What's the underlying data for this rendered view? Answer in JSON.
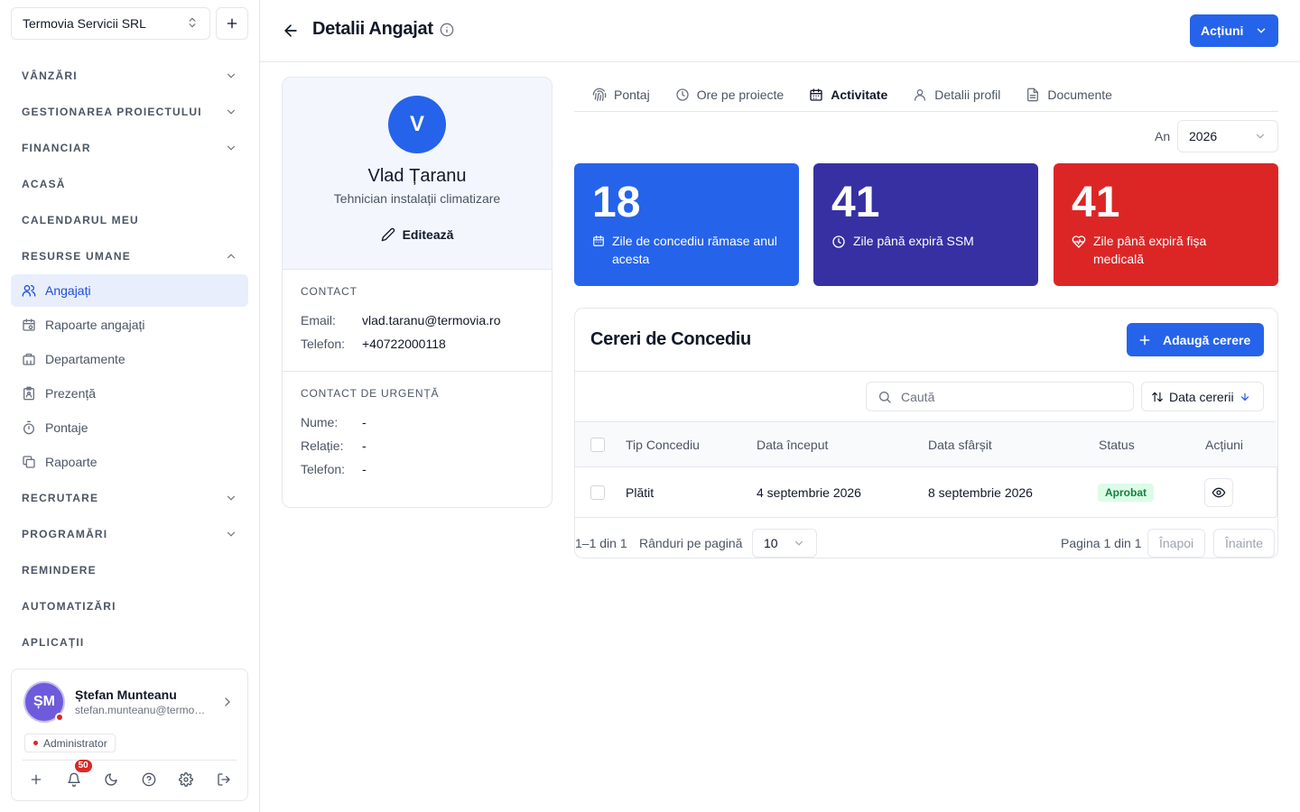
{
  "sidebar": {
    "company": "Termovia Servicii SRL",
    "sections": [
      {
        "label": "VÂNZĂRI"
      },
      {
        "label": "GESTIONAREA PROIECTULUI"
      },
      {
        "label": "FINANCIAR"
      },
      {
        "label": "ACASĂ"
      },
      {
        "label": "CALENDARUL MEU"
      },
      {
        "label": "RESURSE UMANE"
      }
    ],
    "hr_items": [
      {
        "label": "Angajați",
        "icon": "users-icon"
      },
      {
        "label": "Rapoarte angajați",
        "icon": "calendar-report-icon"
      },
      {
        "label": "Departamente",
        "icon": "building-icon"
      },
      {
        "label": "Prezență",
        "icon": "clipboard-icon"
      },
      {
        "label": "Pontaje",
        "icon": "timer-icon"
      },
      {
        "label": "Rapoarte",
        "icon": "copy-icon"
      }
    ],
    "sections_after": [
      {
        "label": "RECRUTARE"
      },
      {
        "label": "PROGRAMĂRI"
      },
      {
        "label": "REMINDERE"
      },
      {
        "label": "AUTOMATIZĂRI"
      },
      {
        "label": "APLICAȚII"
      }
    ],
    "user": {
      "initials": "ȘM",
      "name": "Ștefan Munteanu",
      "email": "stefan.munteanu@termovia.ro",
      "role": "Administrator",
      "notifications": "50"
    }
  },
  "header": {
    "title": "Detalii Angajat",
    "actions_label": "Acțiuni"
  },
  "profile": {
    "initial": "V",
    "name": "Vlad Țaranu",
    "role": "Tehnician instalații climatizare",
    "edit_label": "Editează",
    "contact": {
      "title": "CONTACT",
      "email_label": "Email:",
      "email": "vlad.taranu@termovia.ro",
      "phone_label": "Telefon:",
      "phone": "+40722000118"
    },
    "emergency": {
      "title": "CONTACT DE URGENȚĂ",
      "name_label": "Nume:",
      "name": "-",
      "relation_label": "Relație:",
      "relation": "-",
      "phone_label": "Telefon:",
      "phone": "-"
    }
  },
  "tabs": [
    {
      "label": "Pontaj",
      "icon": "fingerprint-icon"
    },
    {
      "label": "Ore pe proiecte",
      "icon": "clock-icon"
    },
    {
      "label": "Activitate",
      "icon": "calendar-icon"
    },
    {
      "label": "Detalii profil",
      "icon": "user-icon"
    },
    {
      "label": "Documente",
      "icon": "document-icon"
    }
  ],
  "active_tab": "Activitate",
  "year": {
    "label": "An",
    "value": "2026"
  },
  "stats": [
    {
      "value": "18",
      "label": "Zile de concediu rămase anul acesta",
      "color": "#2563eb",
      "icon": "calendar-icon"
    },
    {
      "value": "41",
      "label": "Zile până expiră SSM",
      "color": "#3730a3",
      "icon": "clock-icon"
    },
    {
      "value": "41",
      "label": "Zile până expiră fișa medicală",
      "color": "#dc2626",
      "icon": "heart-pulse-icon"
    }
  ],
  "leave": {
    "title": "Cereri de Concediu",
    "add_label": "Adaugă cerere",
    "search_placeholder": "Caută",
    "sort_label": "Data cererii",
    "columns": [
      "Tip Concediu",
      "Data început",
      "Data sfârșit",
      "Status",
      "Acțiuni"
    ],
    "rows": [
      {
        "type": "Plătit",
        "start": "4 septembrie 2026",
        "end": "8 septembrie 2026",
        "status": "Aprobat"
      }
    ],
    "pager": {
      "range": "1–1 din 1",
      "rows_per_page_label": "Rânduri pe pagină",
      "rows_per_page": "10",
      "page_info": "Pagina 1 din 1",
      "prev_label": "Înapoi",
      "next_label": "Înainte"
    }
  }
}
